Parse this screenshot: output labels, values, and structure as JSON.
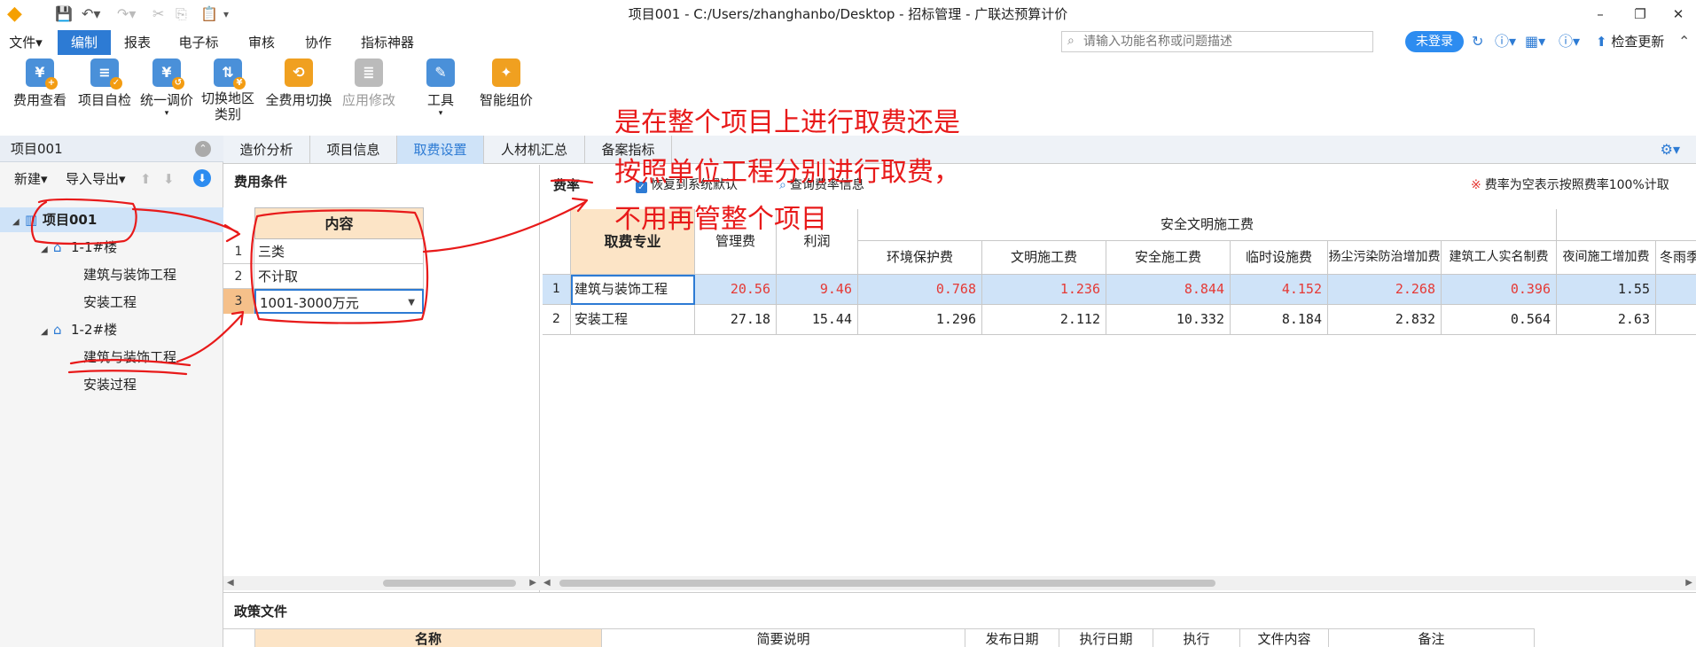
{
  "titlebar": {
    "title": "项目001 - C:/Users/zhanghanbo/Desktop - 招标管理 - 广联达预算计价",
    "min_label": "–",
    "restore_label": "❐",
    "close_label": "✕"
  },
  "menubar": {
    "items": [
      "文件▾",
      "编制",
      "报表",
      "电子标",
      "审核",
      "协作",
      "指标神器"
    ],
    "search_placeholder": "请输入功能名称或问题描述",
    "login_label": "未登录",
    "check_update_label": "检查更新"
  },
  "ribbon": {
    "buttons": [
      {
        "label": "费用查看",
        "icon": "fee-view-icon"
      },
      {
        "label": "项目自检",
        "icon": "self-check-icon"
      },
      {
        "label": "统一调价",
        "icon": "price-adjust-icon",
        "dropdown": true
      },
      {
        "label": "切换地区",
        "label2": "类别",
        "icon": "switch-region-icon"
      },
      {
        "label": "全费用切换",
        "icon": "full-fee-switch-icon"
      },
      {
        "label": "应用修改",
        "icon": "apply-change-icon",
        "disabled": true
      },
      {
        "label": "工具",
        "icon": "tools-icon",
        "dropdown": true
      },
      {
        "label": "智能组价",
        "icon": "smart-pricing-icon"
      }
    ]
  },
  "leftpanel": {
    "title": "项目001",
    "new_label": "新建▾",
    "import_export_label": "导入导出▾",
    "tree": [
      {
        "label": "项目001",
        "level": 0,
        "icon": "project-icon",
        "selected": true,
        "expanded": true
      },
      {
        "label": "1-1#楼",
        "level": 1,
        "icon": "building-icon",
        "expanded": true
      },
      {
        "label": "建筑与装饰工程",
        "level": 2
      },
      {
        "label": "安装工程",
        "level": 2
      },
      {
        "label": "1-2#楼",
        "level": 1,
        "icon": "building-icon",
        "expanded": true
      },
      {
        "label": "建筑与装饰工程",
        "level": 2
      },
      {
        "label": "安装过程",
        "level": 2
      }
    ]
  },
  "tabs": [
    "造价分析",
    "项目信息",
    "取费设置",
    "人材机汇总",
    "备案指标"
  ],
  "conditions": {
    "title": "费用条件",
    "header": "内容",
    "rows": [
      {
        "num": "1",
        "value": "三类"
      },
      {
        "num": "2",
        "value": "不计取"
      },
      {
        "num": "3",
        "value": "1001-3000万元"
      }
    ]
  },
  "rates": {
    "title": "费率",
    "restore_default_label": "恢复到系统默认",
    "query_label": "查询费率信息",
    "note": "费率为空表示按照费率100%计取",
    "headers": {
      "spec": "取费专业",
      "mgmt": "管理费",
      "profit": "利润",
      "safety_group": "安全文明施工费",
      "env": "环境保护费",
      "civil": "文明施工费",
      "safety": "安全施工费",
      "temp": "临时设施费",
      "dust": "扬尘污染防治增加费",
      "realname": "建筑工人实名制费",
      "night": "夜间施工增加费",
      "winter": "冬雨季"
    },
    "rows": [
      {
        "num": "1",
        "spec": "建筑与装饰工程",
        "mgmt": "20.56",
        "profit": "9.46",
        "env": "0.768",
        "civil": "1.236",
        "safety": "8.844",
        "temp": "4.152",
        "dust": "2.268",
        "realname": "0.396",
        "night": "1.55"
      },
      {
        "num": "2",
        "spec": "安装工程",
        "mgmt": "27.18",
        "profit": "15.44",
        "env": "1.296",
        "civil": "2.112",
        "safety": "10.332",
        "temp": "8.184",
        "dust": "2.832",
        "realname": "0.564",
        "night": "2.63"
      }
    ]
  },
  "policy": {
    "title": "政策文件",
    "columns": [
      "名称",
      "简要说明",
      "发布日期",
      "执行日期",
      "执行",
      "文件内容",
      "备注"
    ]
  },
  "annotation": {
    "lines": [
      "是在整个项目上进行取费还是",
      "按照单位工程分别进行取费，",
      "不用再管整个项目"
    ],
    "color": "#e81a1a"
  }
}
